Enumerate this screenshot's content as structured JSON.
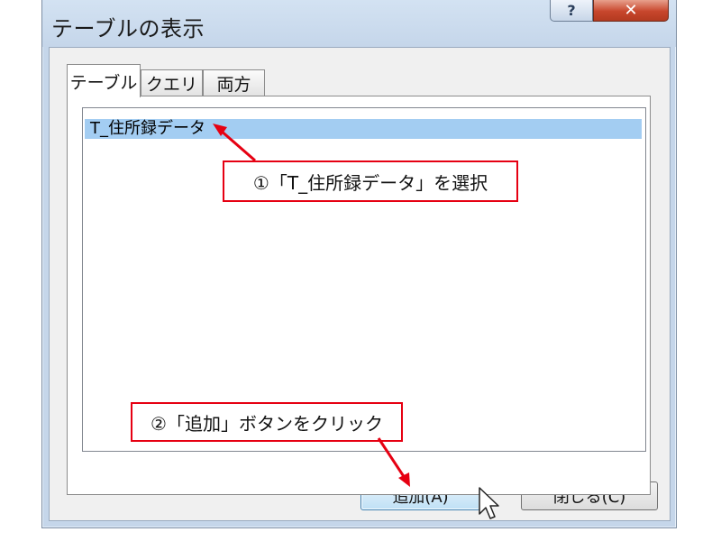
{
  "window": {
    "title": "テーブルの表示",
    "help_label": "?",
    "close_label": "✕"
  },
  "tabs": [
    {
      "label": "テーブル",
      "active": true
    },
    {
      "label": "クエリ",
      "active": false
    },
    {
      "label": "両方",
      "active": false
    }
  ],
  "list": {
    "items": [
      {
        "label": "T_住所録データ",
        "selected": true
      }
    ]
  },
  "buttons": {
    "add_label": "追加(A)",
    "close_label": "閉じる(C)"
  },
  "annotations": {
    "step1": "①「T_住所録データ」を選択",
    "step2": "②「追加」ボタンをクリック"
  },
  "colors": {
    "annotation": "#e60012",
    "selection": "#a3cdf2"
  }
}
